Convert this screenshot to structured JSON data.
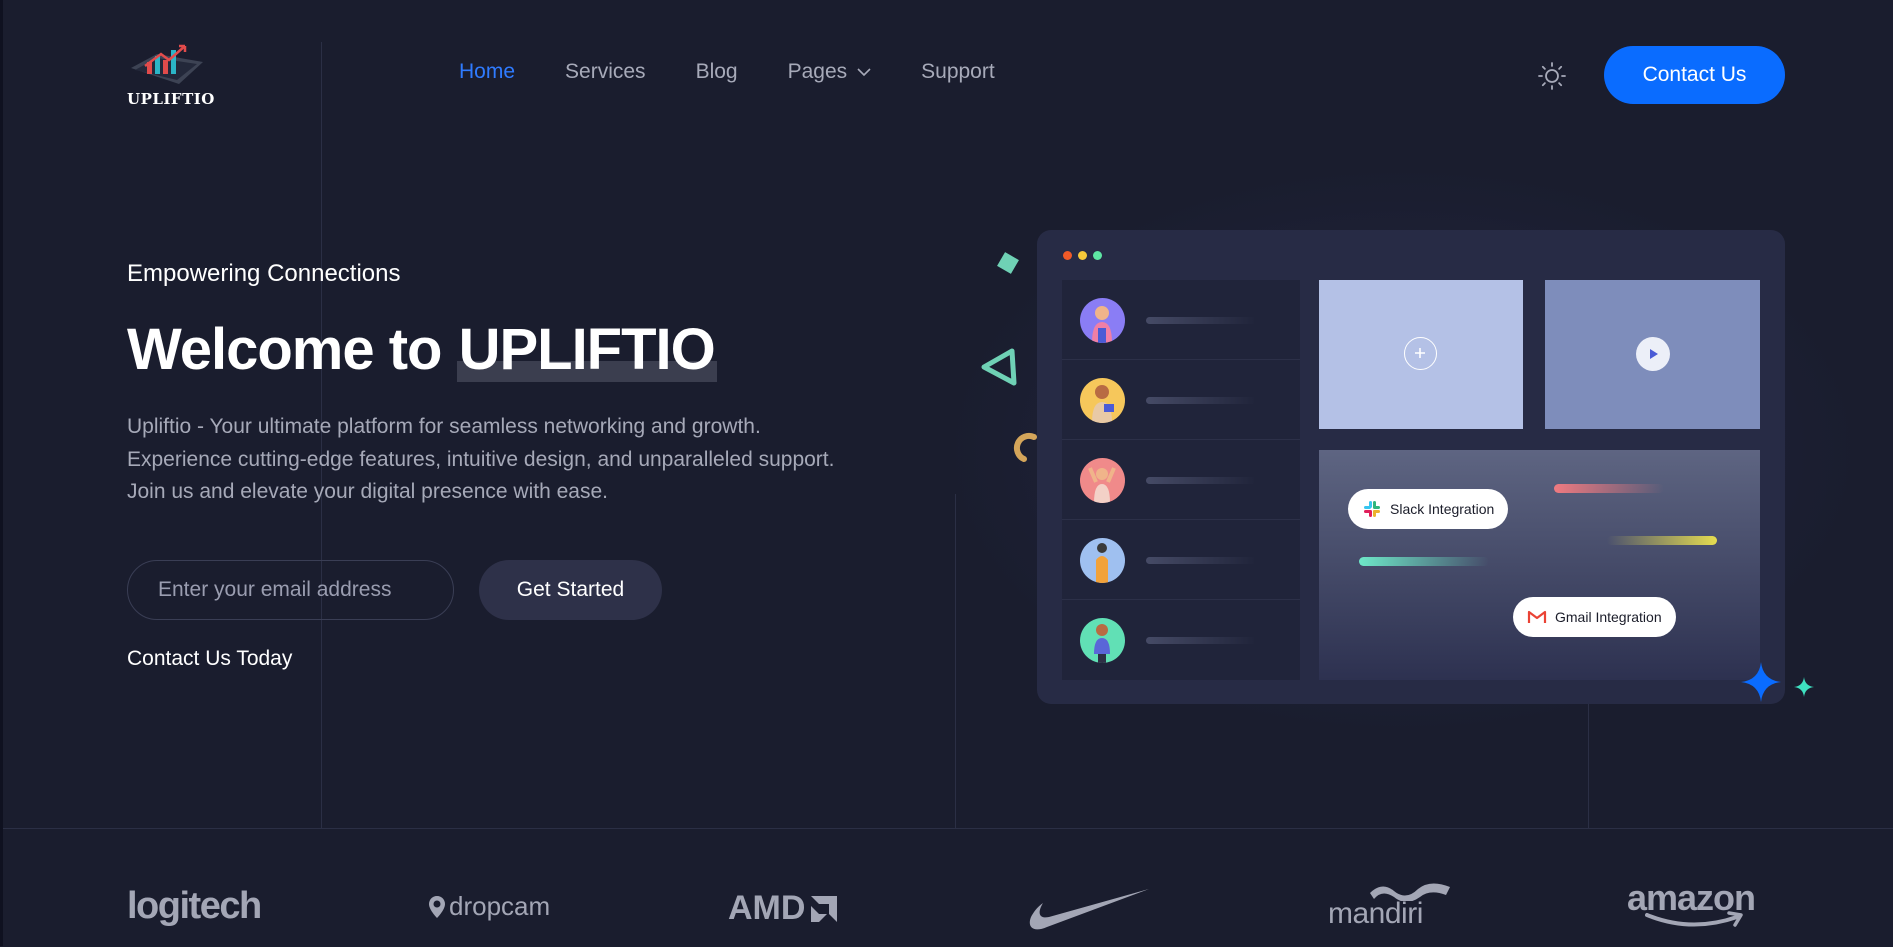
{
  "header": {
    "logo_text": "UPLIFTIO",
    "nav": [
      {
        "label": "Home"
      },
      {
        "label": "Services"
      },
      {
        "label": "Blog"
      },
      {
        "label": "Pages"
      },
      {
        "label": "Support"
      }
    ],
    "contact_button": "Contact Us",
    "theme_icon": "sun-icon"
  },
  "hero": {
    "eyebrow": "Empowering Connections",
    "title_prefix": "Welcome to ",
    "title_brand": "UPLIFTIO",
    "description_lines": [
      "Upliftio - Your ultimate platform for seamless networking and growth.",
      "Experience cutting-edge features, intuitive design, and unparalleled support.",
      "Join us and elevate your digital presence with ease."
    ],
    "email_placeholder": "Enter your email address",
    "get_started": "Get Started",
    "contact_link": "Contact Us Today"
  },
  "illustration": {
    "slack_label": "Slack Integration",
    "gmail_label": "Gmail Integration",
    "window_dot_colors": [
      "#f05a28",
      "#f5c83a",
      "#5ee6a3"
    ],
    "avatar_colors": [
      "#8a7df5",
      "#f6c75b",
      "#f08a8a",
      "#9fc0f0",
      "#61e0b5"
    ]
  },
  "brands": [
    {
      "name": "logitech"
    },
    {
      "name": "dropcam"
    },
    {
      "name": "AMD"
    },
    {
      "name": "nike-logo"
    },
    {
      "name": "mandiri"
    },
    {
      "name": "amazon"
    }
  ],
  "colors": {
    "background": "#1a1d2e",
    "accent": "#0a6cff",
    "active_nav": "#2f7bff"
  }
}
